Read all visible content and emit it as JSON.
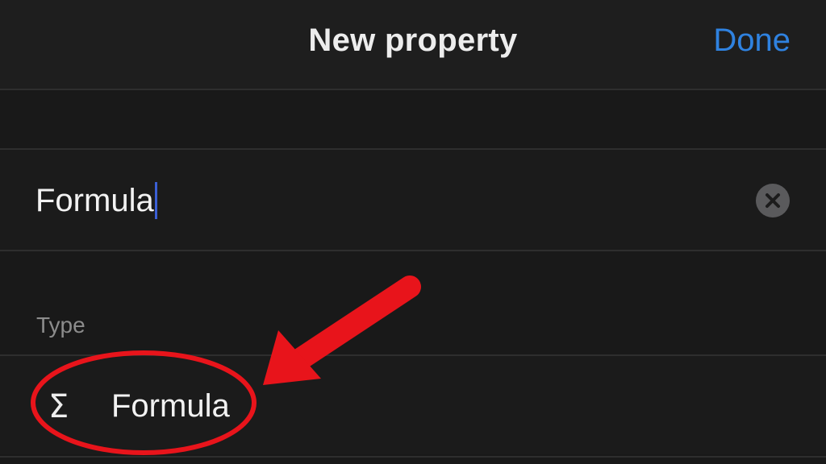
{
  "nav": {
    "title": "New property",
    "done_label": "Done"
  },
  "name_field": {
    "value": "Formula"
  },
  "type_section": {
    "label": "Type",
    "selected": {
      "icon": "sigma-icon",
      "glyph": "Σ",
      "label": "Formula"
    }
  },
  "colors": {
    "accent": "#2f82e0",
    "caret": "#3a5fd4",
    "annotation": "#e8141b"
  }
}
